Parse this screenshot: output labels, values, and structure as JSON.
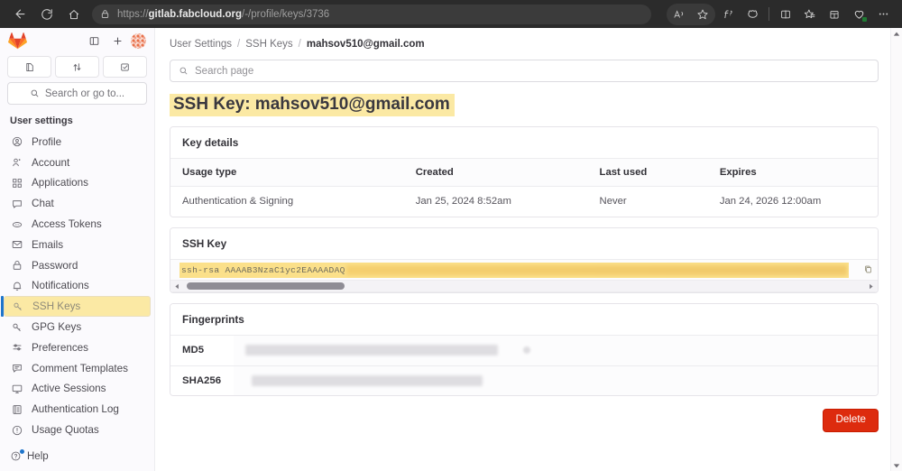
{
  "browser": {
    "url_prefix": "https://",
    "url_domain": "gitlab.fabcloud.org",
    "url_path": "/-/profile/keys/3736",
    "back_icon": "back-arrow-icon",
    "reload_icon": "reload-icon",
    "home_icon": "home-icon",
    "lock_icon": "lock-icon",
    "read_aloud_icon": "read-aloud-icon",
    "favorite_icon": "star-icon",
    "split_screen_icon": "split-screen-icon",
    "copilot_icon": "copilot-icon",
    "collections_icon": "collections-icon",
    "browser_essentials_icon": "heart-icon",
    "settings_icon": "more-options-icon",
    "font_icon": "font-style-icon"
  },
  "sidebar": {
    "logo_icon": "gitlab-logo",
    "toggle_icon": "sidebar-toggle-icon",
    "new_icon": "plus-icon",
    "avatar_icon": "user-avatar",
    "pills": [
      {
        "name": "issues",
        "icon": "issues-icon"
      },
      {
        "name": "merge-requests",
        "icon": "merge-request-icon"
      },
      {
        "name": "todos",
        "icon": "todo-checkbox-icon"
      }
    ],
    "search_placeholder": "Search or go to...",
    "search_icon": "search-icon",
    "section_title": "User settings",
    "items": [
      {
        "label": "Profile",
        "icon": "profile-icon",
        "active": false
      },
      {
        "label": "Account",
        "icon": "account-icon",
        "active": false
      },
      {
        "label": "Applications",
        "icon": "applications-icon",
        "active": false
      },
      {
        "label": "Chat",
        "icon": "chat-icon",
        "active": false
      },
      {
        "label": "Access Tokens",
        "icon": "token-icon",
        "active": false
      },
      {
        "label": "Emails",
        "icon": "email-icon",
        "active": false
      },
      {
        "label": "Password",
        "icon": "lock-icon",
        "active": false
      },
      {
        "label": "Notifications",
        "icon": "bell-icon",
        "active": false
      },
      {
        "label": "SSH Keys",
        "icon": "key-icon",
        "active": true
      },
      {
        "label": "GPG Keys",
        "icon": "key-icon",
        "active": false
      },
      {
        "label": "Preferences",
        "icon": "preferences-icon",
        "active": false
      },
      {
        "label": "Comment Templates",
        "icon": "comment-icon",
        "active": false
      },
      {
        "label": "Active Sessions",
        "icon": "monitor-icon",
        "active": false
      },
      {
        "label": "Authentication Log",
        "icon": "log-icon",
        "active": false
      },
      {
        "label": "Usage Quotas",
        "icon": "quota-icon",
        "active": false
      }
    ],
    "help_label": "Help",
    "help_icon": "question-circle-icon"
  },
  "breadcrumb": {
    "items": [
      "User Settings",
      "SSH Keys",
      "mahsov510@gmail.com"
    ],
    "separator": "/"
  },
  "search_page": {
    "placeholder": "Search page",
    "icon": "search-icon"
  },
  "page": {
    "title": "SSH Key: mahsov510@gmail.com",
    "title_highlight_color": "#fbe9a4"
  },
  "key_details": {
    "card_title": "Key details",
    "columns": [
      "Usage type",
      "Created",
      "Last used",
      "Expires"
    ],
    "rows": [
      {
        "usage_type": "Authentication & Signing",
        "created": "Jan 25, 2024 8:52am",
        "last_used": "Never",
        "expires": "Jan 24, 2026 12:00am"
      }
    ]
  },
  "ssh_key": {
    "card_title": "SSH Key",
    "value_visible": "ssh-rsa AAAAB3NzaC1yc2EAAAADAQ",
    "value_redacted": true,
    "highlight_color": "#fbe08a",
    "copy_icon": "copy-clipboard-icon",
    "scroll_left_icon": "scroll-left-arrow",
    "scroll_right_icon": "scroll-right-arrow"
  },
  "fingerprints": {
    "card_title": "Fingerprints",
    "rows": [
      {
        "label": "MD5",
        "value": "",
        "redacted": true
      },
      {
        "label": "SHA256",
        "value": "",
        "redacted": true
      }
    ]
  },
  "actions": {
    "delete_label": "Delete",
    "delete_color": "#dd2b0e"
  }
}
